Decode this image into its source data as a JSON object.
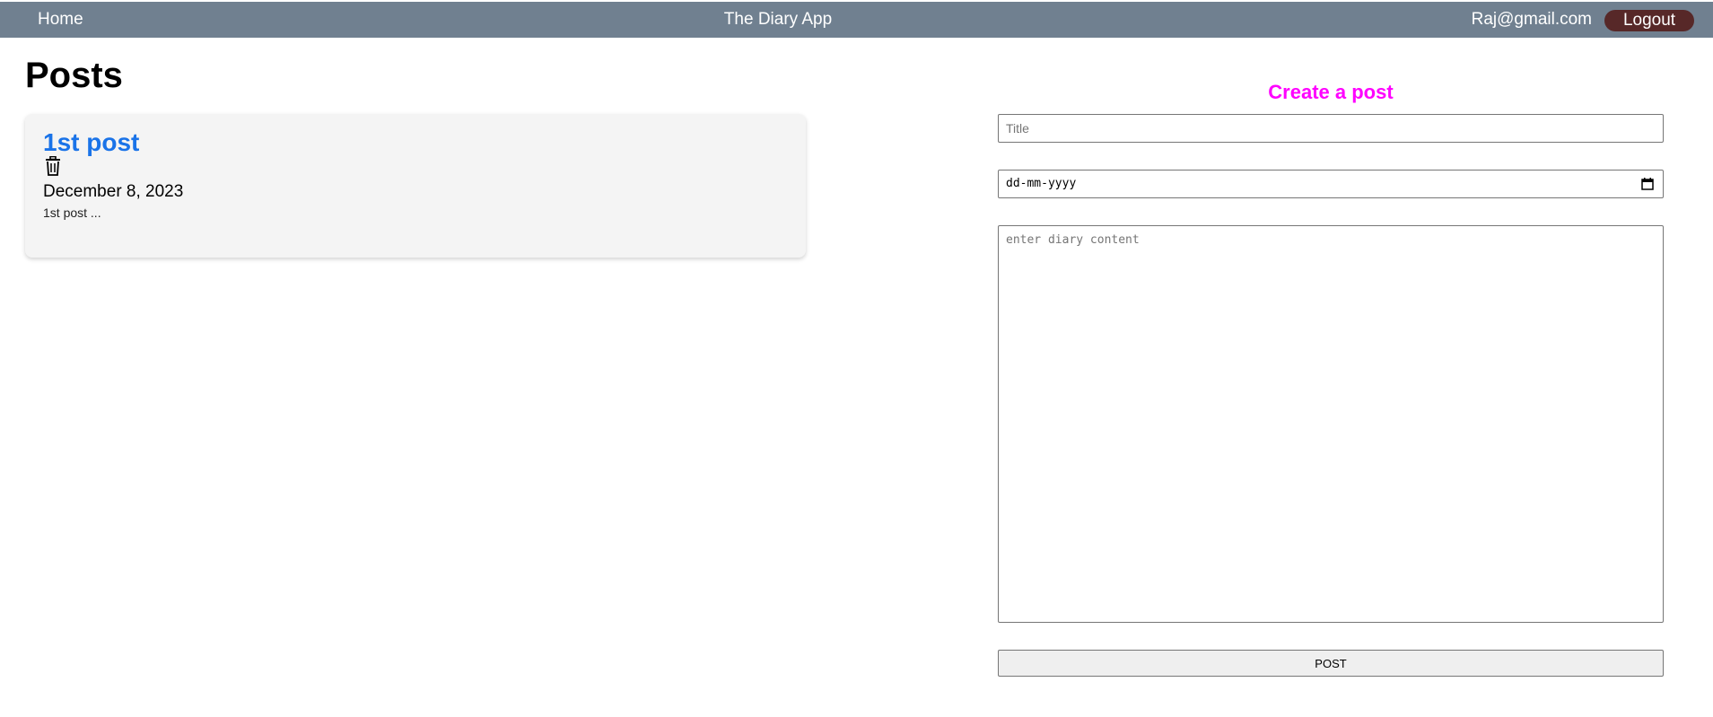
{
  "nav": {
    "home_label": "Home",
    "app_title": "The Diary App",
    "user_email": "Raj@gmail.com",
    "logout_label": "Logout"
  },
  "posts_section": {
    "heading": "Posts",
    "posts": [
      {
        "title": "1st post",
        "date": "December 8, 2023",
        "excerpt": "1st post ...",
        "delete_icon": "trash-icon"
      }
    ]
  },
  "create_form": {
    "heading": "Create a post",
    "title_placeholder": "Title",
    "date_placeholder": "dd-mm-yyyy",
    "content_placeholder": "enter diary content",
    "submit_label": "POST",
    "calendar_icon": "calendar-icon"
  },
  "colors": {
    "navbar_bg": "#708090",
    "logout_bg": "#572828",
    "post_title": "#1a73e8",
    "create_heading": "#ff00ff",
    "card_bg": "#f4f4f4"
  }
}
